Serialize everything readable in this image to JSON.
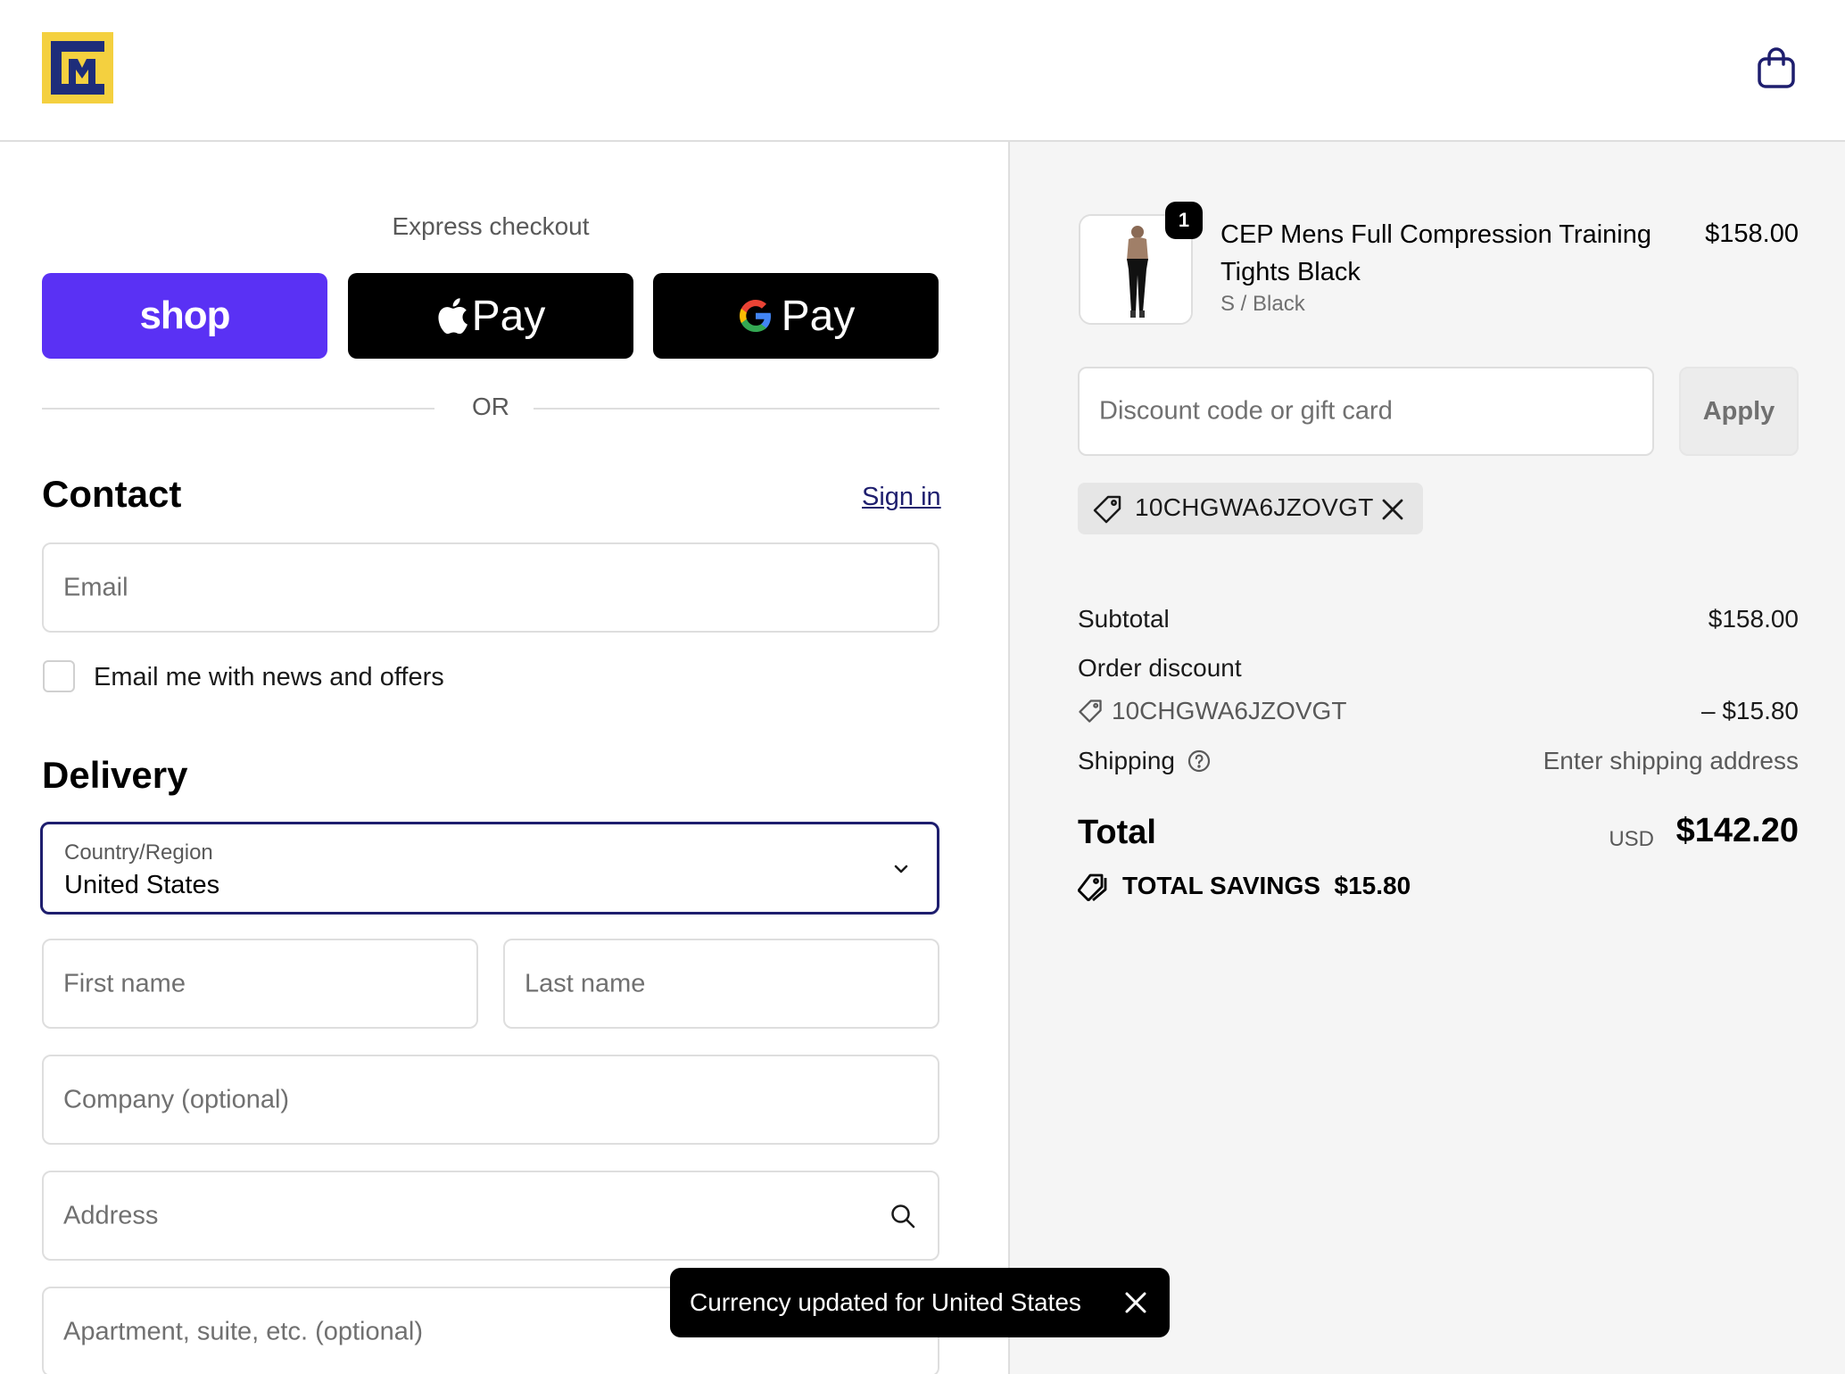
{
  "colors": {
    "shop_pay": "#5a31f4",
    "accent": "#1e1e6e",
    "sidebar_bg": "#f5f5f5"
  },
  "header": {
    "logo_icon": "store-logo-icon",
    "cart_icon": "shopping-bag-icon"
  },
  "express": {
    "title": "Express checkout",
    "shop_label": "shop",
    "apple_label": "Pay",
    "google_label": "Pay",
    "or_label": "OR"
  },
  "contact": {
    "title": "Contact",
    "sign_in": "Sign in",
    "email_placeholder": "Email",
    "newsletter_label": "Email me with news and offers"
  },
  "delivery": {
    "title": "Delivery",
    "country_label": "Country/Region",
    "country_value": "United States",
    "first_name": "First name",
    "last_name": "Last name",
    "company": "Company (optional)",
    "address": "Address",
    "apartment": "Apartment, suite, etc. (optional)"
  },
  "order": {
    "product": {
      "quantity": "1",
      "name": "CEP Mens Full Compression Training Tights Black",
      "variant": "S / Black",
      "price": "$158.00"
    },
    "discount_placeholder": "Discount code or gift card",
    "apply_label": "Apply",
    "applied_code": "10CHGWA6JZOVGT",
    "subtotal_label": "Subtotal",
    "subtotal_value": "$158.00",
    "order_discount_label": "Order discount",
    "discount_code": "10CHGWA6JZOVGT",
    "discount_value": "– $15.80",
    "shipping_label": "Shipping",
    "shipping_value": "Enter shipping address",
    "total_label": "Total",
    "total_currency": "USD",
    "total_value": "$142.20",
    "savings_label": "TOTAL SAVINGS",
    "savings_value": "$15.80"
  },
  "toast": {
    "message": "Currency updated for United States"
  }
}
